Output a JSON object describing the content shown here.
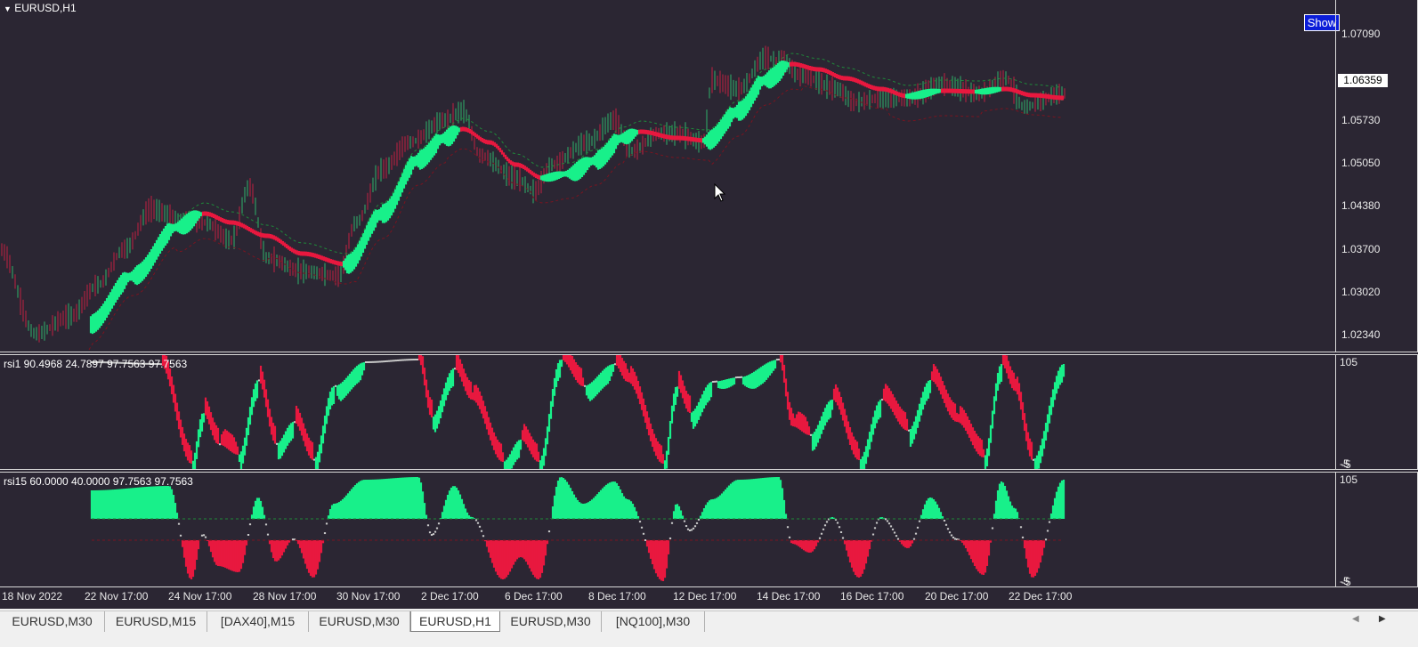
{
  "main_pane": {
    "title": "EURUSD,H1",
    "show_button": "Show",
    "price_labels": [
      "1.07090",
      "1.05730",
      "1.05050",
      "1.04380",
      "1.03700",
      "1.03020",
      "1.02340"
    ],
    "current_price": "1.06359"
  },
  "rsi1_pane": {
    "title": "rsi1 90.4968 24.7897 97.7563 97.7563",
    "levels": [
      "105",
      "-5",
      "-5"
    ]
  },
  "rsi15_pane": {
    "title": "rsi15 60.0000 40.0000 97.7563 97.7563",
    "levels": [
      "105",
      "-5",
      "-5"
    ]
  },
  "time_axis": [
    "18 Nov 2022",
    "22 Nov 17:00",
    "24 Nov 17:00",
    "28 Nov 17:00",
    "30 Nov 17:00",
    "2 Dec 17:00",
    "6 Dec 17:00",
    "8 Dec 17:00",
    "12 Dec 17:00",
    "14 Dec 17:00",
    "16 Dec 17:00",
    "20 Dec 17:00",
    "22 Dec 17:00"
  ],
  "tabs": [
    {
      "label": "EURUSD,M30",
      "active": false
    },
    {
      "label": "EURUSD,M15",
      "active": false
    },
    {
      "label": "[DAX40],M15",
      "active": false
    },
    {
      "label": "EURUSD,M30",
      "active": false
    },
    {
      "label": "EURUSD,H1",
      "active": true
    },
    {
      "label": "EURUSD,M30",
      "active": false
    },
    {
      "label": "[NQ100],M30",
      "active": false
    }
  ],
  "colors": {
    "background": "#2b2633",
    "bull": "#18f08a",
    "bear": "#e8183f",
    "neutral": "#c8c8c8",
    "candle_up": "#2fb36b",
    "candle_down": "#c02040"
  },
  "icons": {
    "scroll_left": "triangle-left-icon",
    "scroll_right": "triangle-right-icon",
    "collapse": "triangle-down-icon"
  }
}
